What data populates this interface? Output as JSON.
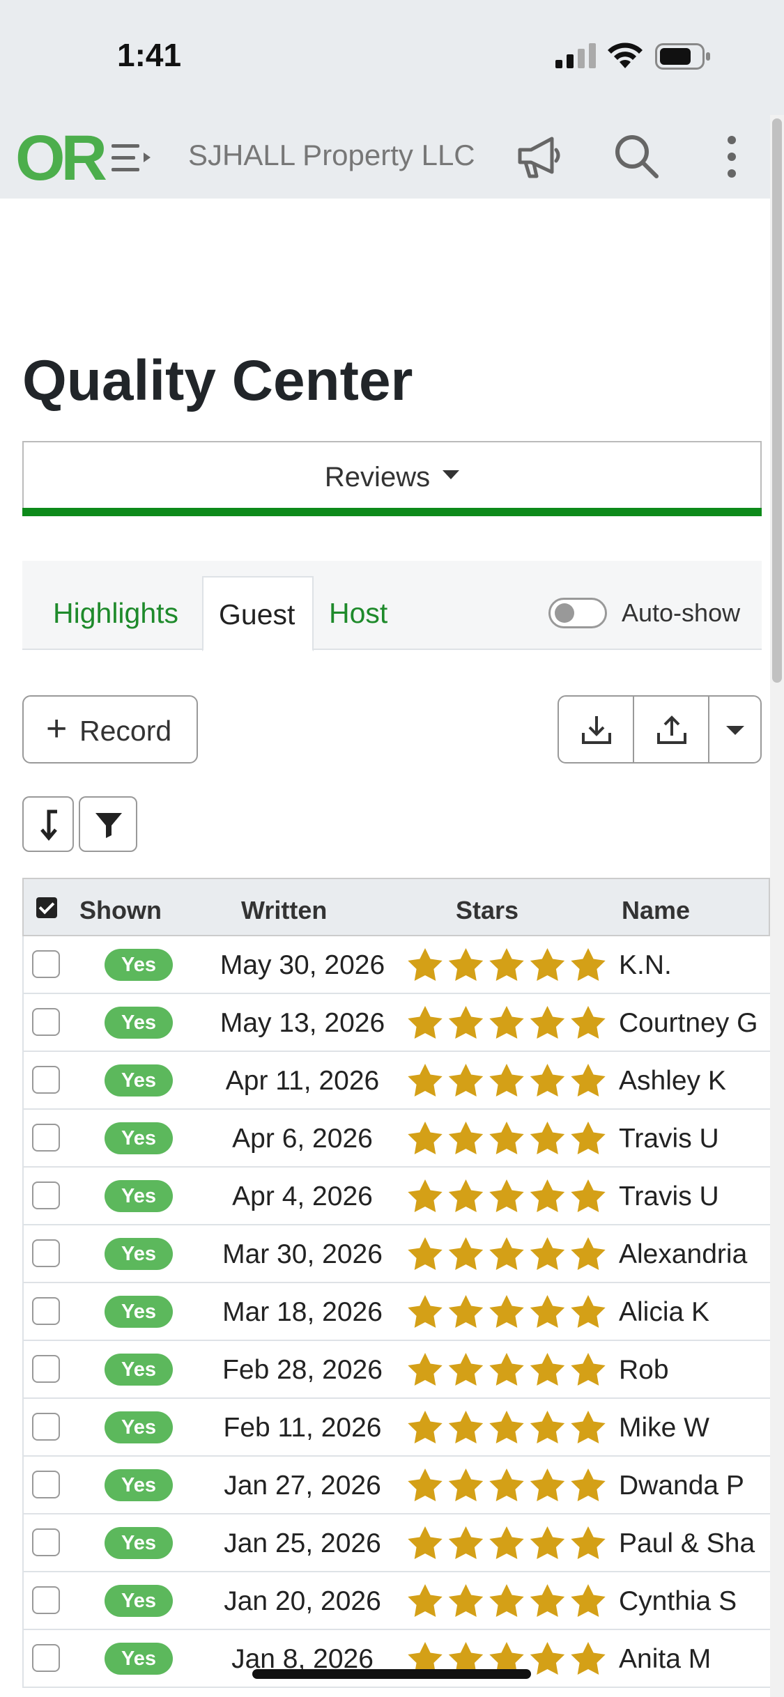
{
  "status_bar": {
    "time": "1:41"
  },
  "navbar": {
    "logo": "OR",
    "company": "SJHALL Property LLC"
  },
  "page": {
    "title": "Quality Center"
  },
  "dropdown": {
    "label": "Reviews"
  },
  "tabs": [
    {
      "label": "Highlights",
      "active": false
    },
    {
      "label": "Guest",
      "active": true
    },
    {
      "label": "Host",
      "active": false
    }
  ],
  "toggle": {
    "label": "Auto-show",
    "on": false
  },
  "toolbar": {
    "record_label": "Record",
    "record_icon": "+"
  },
  "colors": {
    "accent": "#1e8a2b",
    "badge": "#5cb85c",
    "star": "#d4a017",
    "underline": "#0d8a1a"
  },
  "table": {
    "columns": [
      "Shown",
      "Written",
      "Stars",
      "Name"
    ],
    "rows": [
      {
        "shown": "Yes",
        "written": "May 30, 2026",
        "stars": 5,
        "name": "K.N."
      },
      {
        "shown": "Yes",
        "written": "May 13, 2026",
        "stars": 5,
        "name": "Courtney G"
      },
      {
        "shown": "Yes",
        "written": "Apr 11, 2026",
        "stars": 5,
        "name": "Ashley K"
      },
      {
        "shown": "Yes",
        "written": "Apr 6, 2026",
        "stars": 5,
        "name": "Travis U"
      },
      {
        "shown": "Yes",
        "written": "Apr 4, 2026",
        "stars": 5,
        "name": "Travis U"
      },
      {
        "shown": "Yes",
        "written": "Mar 30, 2026",
        "stars": 5,
        "name": "Alexandria"
      },
      {
        "shown": "Yes",
        "written": "Mar 18, 2026",
        "stars": 5,
        "name": "Alicia K"
      },
      {
        "shown": "Yes",
        "written": "Feb 28, 2026",
        "stars": 5,
        "name": "Rob"
      },
      {
        "shown": "Yes",
        "written": "Feb 11, 2026",
        "stars": 5,
        "name": "Mike W"
      },
      {
        "shown": "Yes",
        "written": "Jan 27, 2026",
        "stars": 5,
        "name": "Dwanda P"
      },
      {
        "shown": "Yes",
        "written": "Jan 25, 2026",
        "stars": 5,
        "name": "Paul & Sha"
      },
      {
        "shown": "Yes",
        "written": "Jan 20, 2026",
        "stars": 5,
        "name": "Cynthia S"
      },
      {
        "shown": "Yes",
        "written": "Jan 8, 2026",
        "stars": 5,
        "name": "Anita M"
      }
    ]
  }
}
